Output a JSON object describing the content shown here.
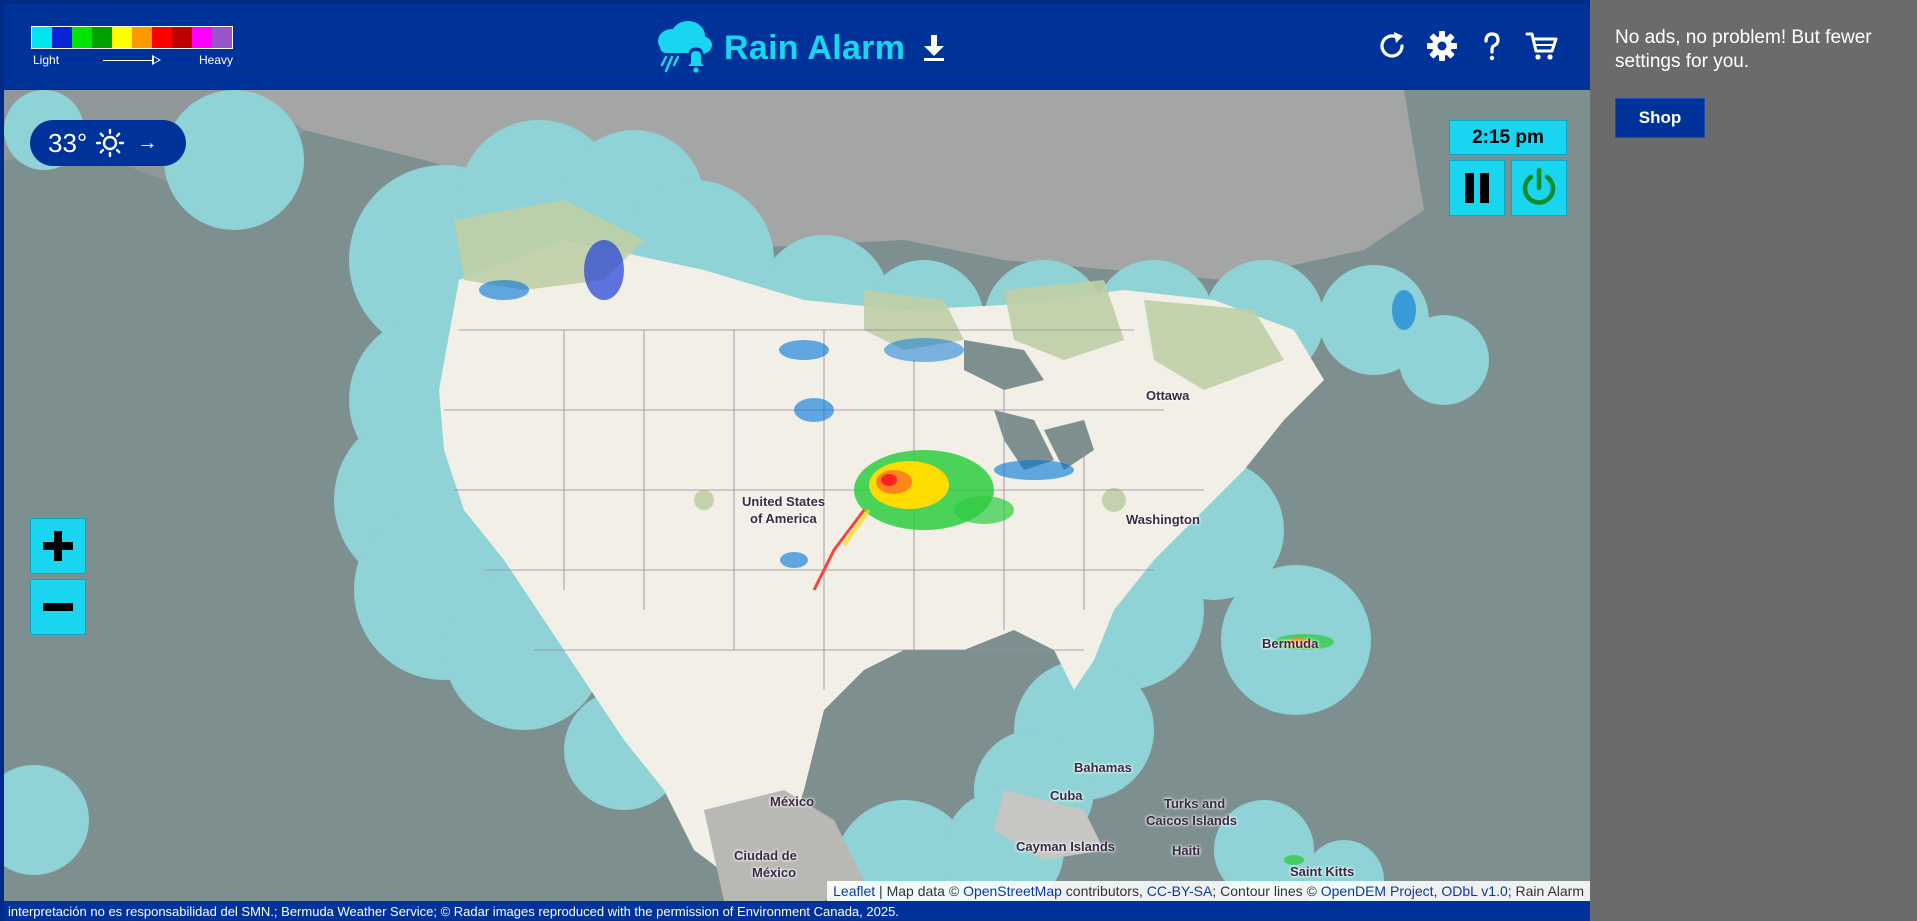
{
  "header": {
    "title": "Rain Alarm",
    "legend": {
      "light_label": "Light",
      "heavy_label": "Heavy",
      "colors": [
        "#00e5ee",
        "#0a22d8",
        "#00e500",
        "#00a000",
        "#ffff00",
        "#ff9900",
        "#ff0000",
        "#c00000",
        "#ff00ff",
        "#9955cc"
      ]
    },
    "icons": {
      "logo": "rain-alarm-cloud-bell-icon",
      "download": "download-icon",
      "refresh": "refresh-icon",
      "settings": "gear-icon",
      "help": "help-icon",
      "shop": "cart-icon"
    },
    "accent_color": "#19d5ef",
    "brand_color": "#003399"
  },
  "weather": {
    "temperature": "33°",
    "condition_icon": "sun-icon",
    "arrow": "→"
  },
  "playback": {
    "time": "2:15 pm",
    "pause_icon": "pause-icon",
    "power_icon": "power-icon"
  },
  "zoom": {
    "in_icon": "plus-icon",
    "out_icon": "minus-icon"
  },
  "map_labels": {
    "usa_line1": "United States",
    "usa_line2": "of America",
    "ottawa": "Ottawa",
    "washington": "Washington",
    "bermuda": "Bermuda",
    "bahamas": "Bahamas",
    "cuba": "Cuba",
    "turks_line1": "Turks and",
    "turks_line2": "Caicos Islands",
    "cayman": "Cayman Islands",
    "haiti": "Haiti",
    "saint_kitts": "Saint Kitts",
    "mexico": "México",
    "cdmx_line1": "Ciudad de",
    "cdmx_line2": "México"
  },
  "attribution": {
    "leaflet": "Leaflet",
    "sep1": " | Map data © ",
    "osm": "OpenStreetMap",
    "contributors": " contributors, ",
    "ccbysa": "CC-BY-SA",
    "contour": "; Contour lines © ",
    "opendem": "OpenDEM Project",
    "comma": ", ",
    "odbl": "ODbL v1.0",
    "tail": "; Rain Alarm"
  },
  "footer": {
    "credits": "interpretación no es responsabilidad del SMN.; Bermuda Weather Service; © Radar images reproduced with the permission of Environment Canada, 2025."
  },
  "side_panel": {
    "message": "No ads, no problem! But fewer settings for you.",
    "shop_label": "Shop"
  }
}
